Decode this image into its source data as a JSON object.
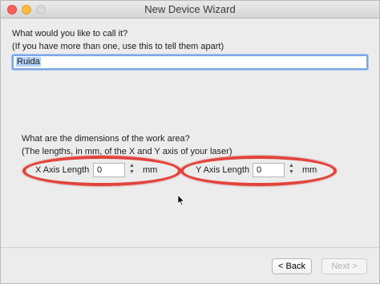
{
  "window": {
    "title": "New Device Wizard"
  },
  "name_section": {
    "question": "What would you like to call it?",
    "hint": "(If you have more than one, use this to tell them apart)",
    "value": "Ruida"
  },
  "dimensions_section": {
    "question": "What are the dimensions of the work area?",
    "hint": "(The lengths, in mm, of the X and Y axis of your laser)",
    "x_axis": {
      "label": "X Axis Length",
      "value": "0",
      "unit": "mm"
    },
    "y_axis": {
      "label": "Y Axis Length",
      "value": "0",
      "unit": "mm"
    }
  },
  "footer": {
    "back_label": "< Back",
    "next_label": "Next >"
  },
  "colors": {
    "annotation_oval": "#e2443b",
    "focus_ring": "#7aa7e6"
  },
  "icons": [
    "close-icon",
    "minimize-icon",
    "zoom-icon",
    "stepper-up-icon",
    "stepper-down-icon",
    "mouse-cursor-icon"
  ]
}
